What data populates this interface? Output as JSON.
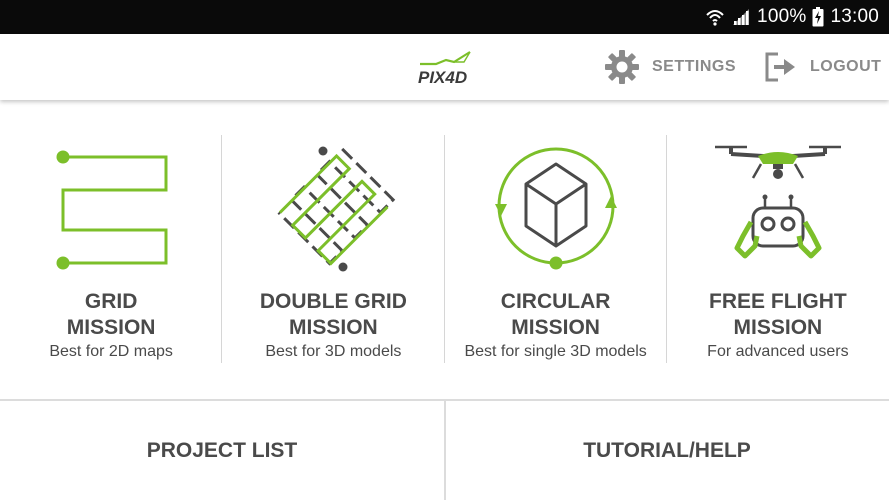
{
  "status_bar": {
    "battery": "100%",
    "time": "13:00",
    "icons": [
      "wifi-icon",
      "signal-icon",
      "battery-charging-icon"
    ]
  },
  "header": {
    "logo_text": "PIX4D",
    "settings_label": "SETTINGS",
    "logout_label": "LOGOUT"
  },
  "missions": [
    {
      "title_line1": "GRID",
      "title_line2": "MISSION",
      "subtitle": "Best for 2D maps",
      "icon": "grid-mission-icon"
    },
    {
      "title_line1": "DOUBLE GRID",
      "title_line2": "MISSION",
      "subtitle": "Best for 3D models",
      "icon": "double-grid-mission-icon"
    },
    {
      "title_line1": "CIRCULAR",
      "title_line2": "MISSION",
      "subtitle": "Best for single 3D models",
      "icon": "circular-mission-icon"
    },
    {
      "title_line1": "FREE FLIGHT",
      "title_line2": "MISSION",
      "subtitle": "For advanced users",
      "icon": "free-flight-mission-icon"
    }
  ],
  "bottom": {
    "project_list_label": "PROJECT LIST",
    "tutorial_label": "TUTORIAL/HELP"
  },
  "colors": {
    "accent_green": "#7cbf2a",
    "icon_dark": "#4a4a4a",
    "header_gray": "#8a8a8a",
    "status_bar": "#0a0a0a"
  }
}
